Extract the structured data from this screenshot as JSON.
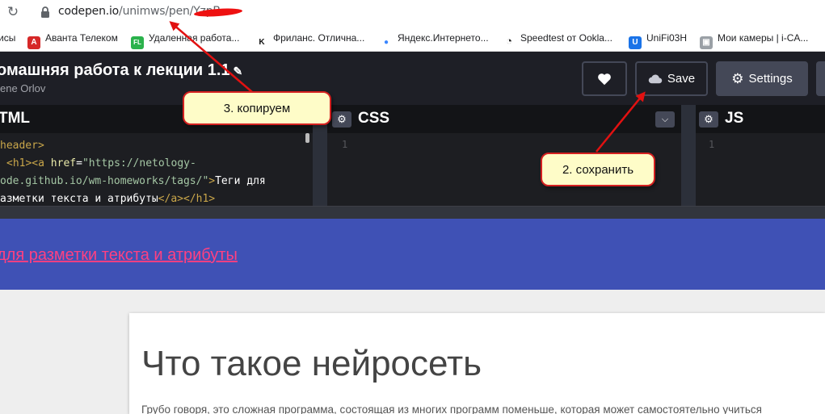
{
  "browser": {
    "reload_icon": "reload-icon",
    "url_host": "codepen.io",
    "url_path": "/unimws/pen/",
    "url_hidden": "YzpB...",
    "bookmarks": [
      {
        "label": "исы",
        "icon": ""
      },
      {
        "label": "Аванта Телеком",
        "icon": "A",
        "color": "#d62828"
      },
      {
        "label": "Удаленная работа...",
        "icon": "FL",
        "color": "#2bb24c"
      },
      {
        "label": "Фриланс. Отлична...",
        "icon": "K",
        "color": "#111111"
      },
      {
        "label": "Яндекс.Интернето...",
        "icon": "●",
        "color": "#3a86ff"
      },
      {
        "label": "Speedtest от Ookla...",
        "icon": "◔",
        "color": "#222222"
      },
      {
        "label": "UniFi03H",
        "icon": "U",
        "color": "#1a73e8"
      },
      {
        "label": "Мои камеры | i-CA...",
        "icon": "▣",
        "color": "#9aa0a6"
      }
    ]
  },
  "header": {
    "title": "омашняя работа к лекции 1.1",
    "author": "ene Orlov",
    "save_label": "Save",
    "settings_label": "Settings"
  },
  "editors": {
    "html_title": "TML",
    "css_title": "CSS",
    "js_title": "JS",
    "css_line": "1",
    "js_line": "1",
    "html_code": [
      "header>",
      "<h1><a href=\"https://netology-",
      "ode.github.io/wm-homeworks/tags/\">Теги для",
      "азметки текста и атрибуты</a></h1>"
    ]
  },
  "preview": {
    "banner_link": "для разметки текста и атрибуты",
    "heading": "Что такое нейросеть",
    "paragraph": "Грубо говоря, это сложная программа, состоящая из многих программ поменьше, которая может самостоятельно учиться"
  },
  "annotations": {
    "step3": "3. копируем",
    "step2": "2. сохранить"
  },
  "colors": {
    "codepen_bg": "#1e1f26",
    "banner_blue": "#3f51b5",
    "link_pink": "#ff4081",
    "arrow_red": "#e11111"
  }
}
